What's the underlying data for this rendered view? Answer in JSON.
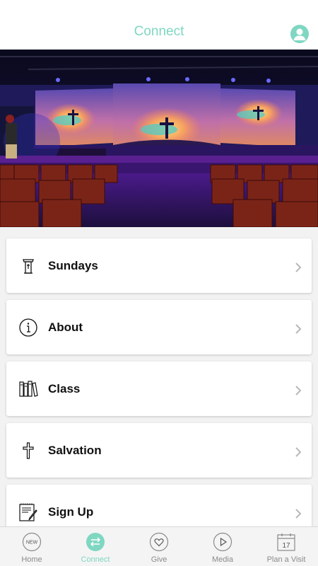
{
  "header": {
    "title": "Connect",
    "profile_icon": "user-avatar-icon"
  },
  "hero": {
    "description_icon": "church-stage-photo"
  },
  "menu": {
    "items": [
      {
        "label": "Sundays",
        "icon": "pulpit-icon"
      },
      {
        "label": "About",
        "icon": "info-icon"
      },
      {
        "label": "Class",
        "icon": "books-icon"
      },
      {
        "label": "Salvation",
        "icon": "cross-icon"
      },
      {
        "label": "Sign Up",
        "icon": "signup-form-icon"
      }
    ]
  },
  "tabbar": {
    "tabs": [
      {
        "label": "Home",
        "icon": "new-badge-icon",
        "active": false,
        "badge_text": "NEW"
      },
      {
        "label": "Connect",
        "icon": "connect-arrows-icon",
        "active": true
      },
      {
        "label": "Give",
        "icon": "heart-icon",
        "active": false
      },
      {
        "label": "Media",
        "icon": "play-icon",
        "active": false
      },
      {
        "label": "Plan a Visit",
        "icon": "calendar-icon",
        "active": false,
        "badge_text": "17"
      }
    ]
  },
  "colors": {
    "accent": "#7fd7c2",
    "tab_inactive": "#8a8a8a",
    "card_bg": "#ffffff",
    "page_bg": "#f2f2f2"
  }
}
